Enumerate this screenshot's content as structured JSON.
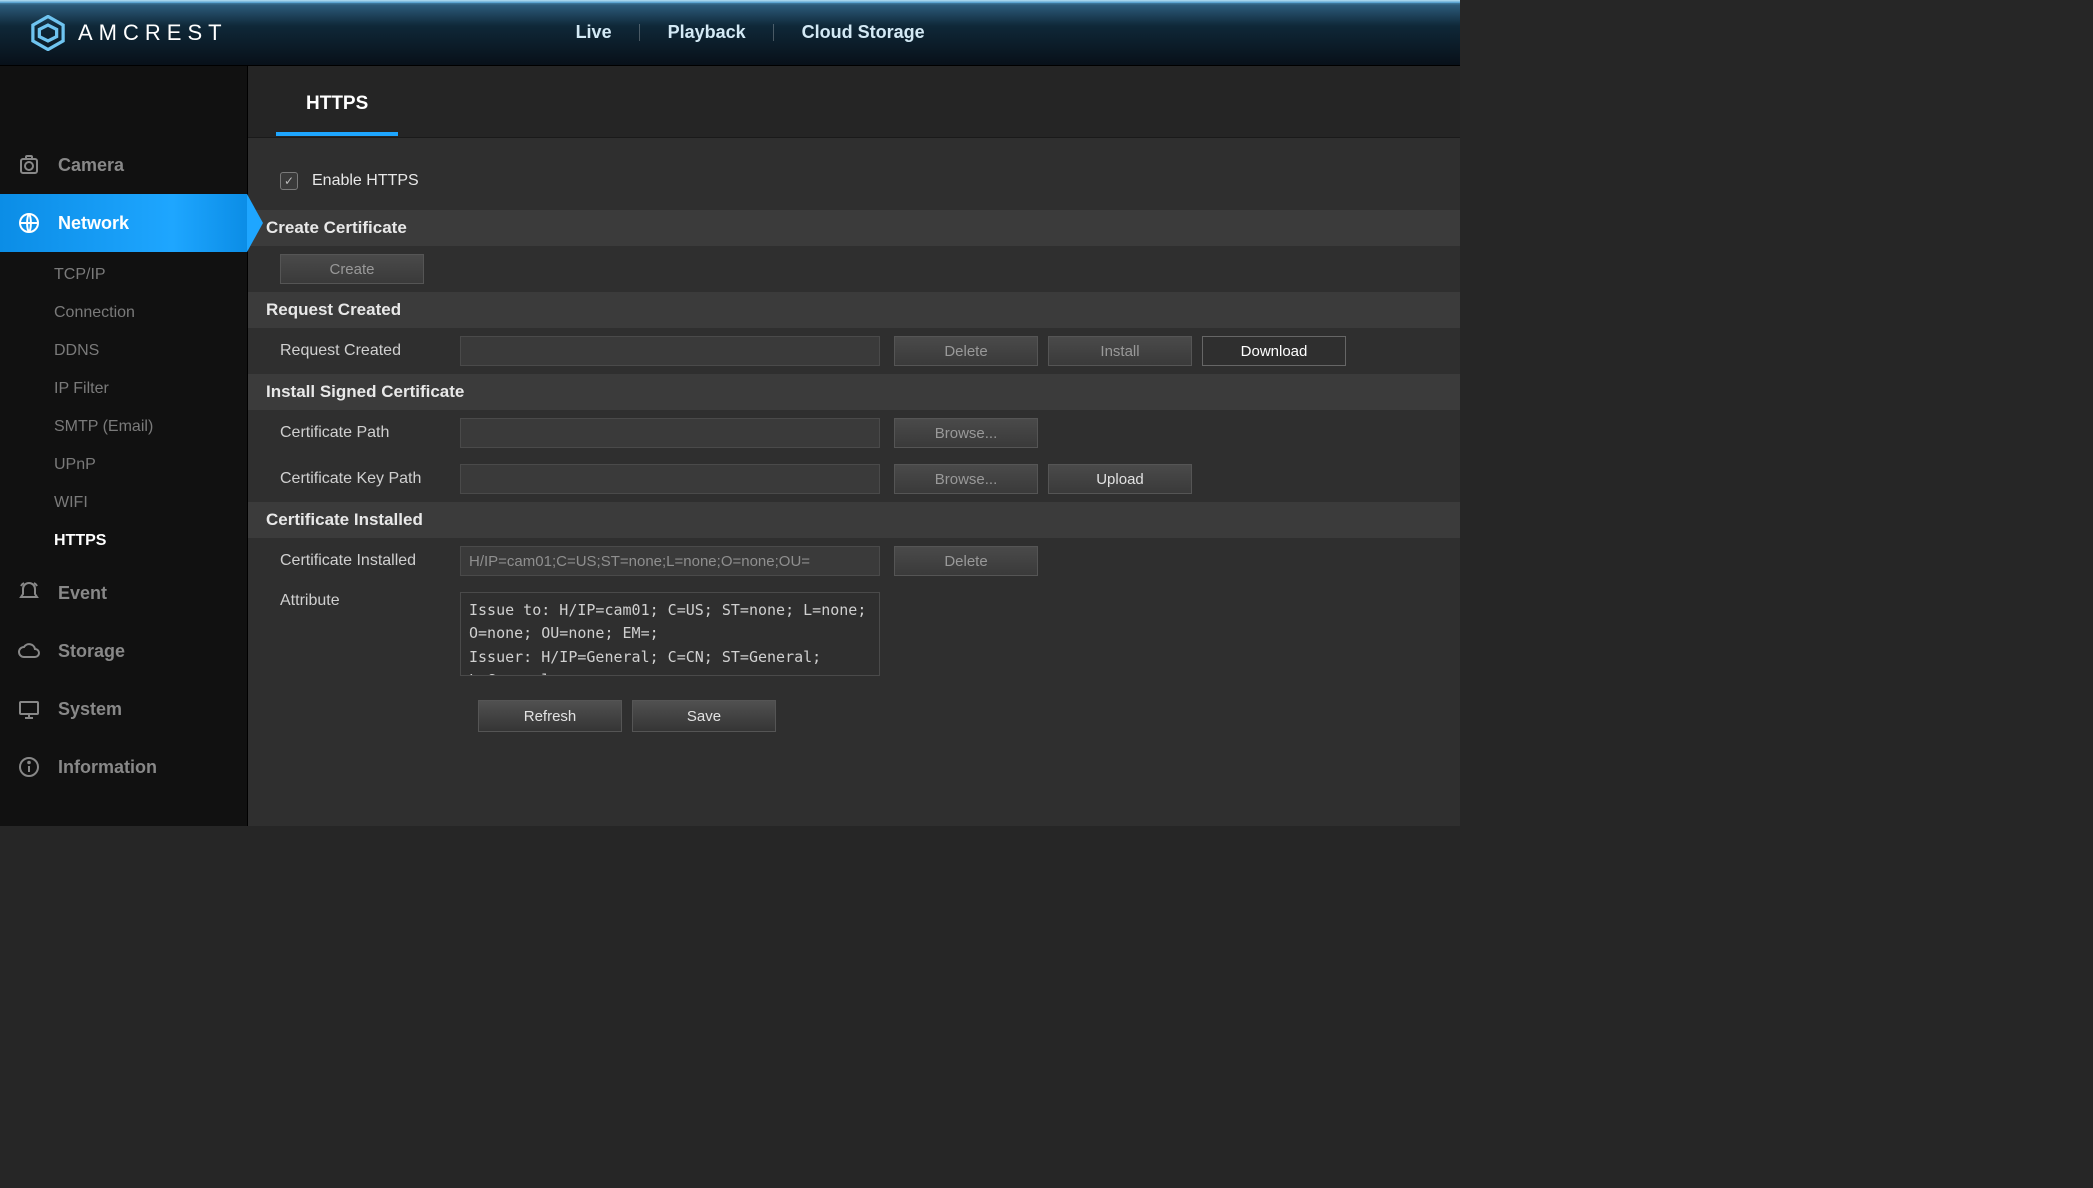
{
  "header": {
    "brand": "AMCREST",
    "nav": [
      "Live",
      "Playback",
      "Cloud Storage"
    ]
  },
  "sidebar": {
    "items": [
      {
        "label": "Camera"
      },
      {
        "label": "Network",
        "active": true
      },
      {
        "label": "Event"
      },
      {
        "label": "Storage"
      },
      {
        "label": "System"
      },
      {
        "label": "Information"
      }
    ],
    "network_sub": [
      "TCP/IP",
      "Connection",
      "DDNS",
      "IP Filter",
      "SMTP (Email)",
      "UPnP",
      "WIFI",
      "HTTPS"
    ]
  },
  "tabs": {
    "active": "HTTPS"
  },
  "form": {
    "enable_https_label": "Enable HTTPS",
    "sections": {
      "create_certificate": "Create Certificate",
      "request_created": "Request Created",
      "install_signed": "Install Signed Certificate",
      "certificate_installed": "Certificate Installed"
    },
    "labels": {
      "request_created": "Request Created",
      "certificate_path": "Certificate Path",
      "certificate_key_path": "Certificate Key Path",
      "certificate_installed": "Certificate Installed",
      "attribute": "Attribute"
    },
    "values": {
      "request_created": "",
      "certificate_path": "",
      "certificate_key_path": "",
      "certificate_installed": "H/IP=cam01;C=US;ST=none;L=none;O=none;OU=",
      "attribute": "Issue to: H/IP=cam01; C=US; ST=none; L=none; O=none; OU=none; EM=;\nIssuer: H/IP=General; C=CN; ST=General; L=General;"
    },
    "buttons": {
      "create": "Create",
      "delete": "Delete",
      "install": "Install",
      "download": "Download",
      "browse": "Browse...",
      "upload": "Upload",
      "refresh": "Refresh",
      "save": "Save"
    }
  }
}
